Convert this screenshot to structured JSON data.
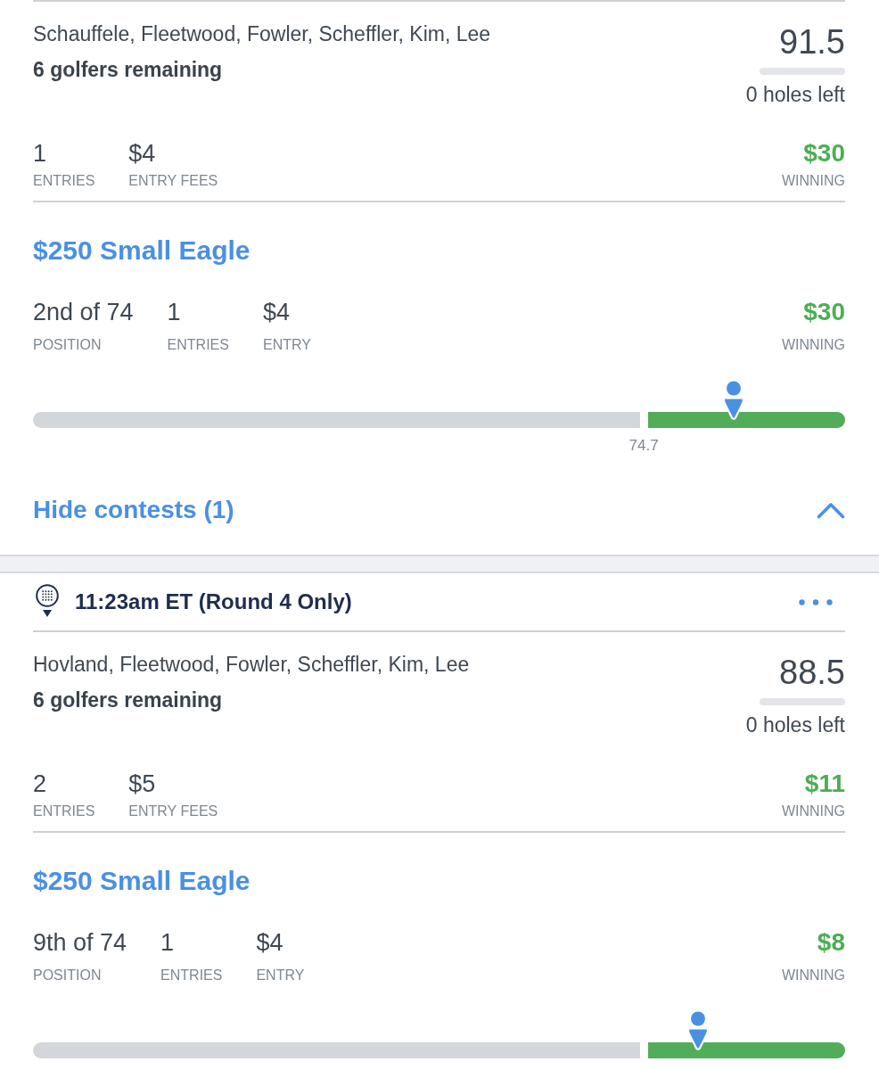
{
  "lineup_groups": [
    {
      "lineup": {
        "golfers": "Schauffele, Fleetwood, Fowler, Scheffler, Kim, Lee",
        "remaining": "6 golfers remaining",
        "score": "91.5",
        "holes_left": "0 holes left"
      },
      "summary": {
        "stats": [
          {
            "value": "1",
            "label": "ENTRIES"
          },
          {
            "value": "$4",
            "label": "ENTRY FEES"
          }
        ],
        "winning": {
          "value": "$30",
          "label": "WINNING"
        }
      },
      "contests": [
        {
          "name": "$250 Small Eagle",
          "stats": [
            {
              "value": "2nd of 74",
              "label": "POSITION"
            },
            {
              "value": "1",
              "label": "ENTRIES"
            },
            {
              "value": "$4",
              "label": "ENTRY"
            }
          ],
          "winning": {
            "value": "$30",
            "label": "WINNING"
          },
          "standings_bar": {
            "payout_zone": {
              "level": 0.248
            },
            "marker": {
              "level": 0.863
            },
            "cash_line_value": "74.7"
          }
        }
      ],
      "toggle": {
        "label": "Hide contests (1)",
        "expanded": true
      }
    },
    {
      "header": {
        "start_time": "11:23am ET (Round 4 Only)"
      },
      "lineup": {
        "golfers": "Hovland, Fleetwood, Fowler, Scheffler, Kim, Lee",
        "remaining": "6 golfers remaining",
        "score": "88.5",
        "holes_left": "0 holes left"
      },
      "summary": {
        "stats": [
          {
            "value": "2",
            "label": "ENTRIES"
          },
          {
            "value": "$5",
            "label": "ENTRY FEES"
          }
        ],
        "winning": {
          "value": "$11",
          "label": "WINNING"
        }
      },
      "contests": [
        {
          "name": "$250 Small Eagle",
          "stats": [
            {
              "value": "9th of 74",
              "label": "POSITION"
            },
            {
              "value": "1",
              "label": "ENTRIES"
            },
            {
              "value": "$4",
              "label": "ENTRY"
            }
          ],
          "winning": {
            "value": "$8",
            "label": "WINNING"
          },
          "standings_bar": {
            "payout_zone": {
              "level": 0.248
            },
            "marker": {
              "level": 0.819
            }
          }
        }
      ]
    }
  ]
}
